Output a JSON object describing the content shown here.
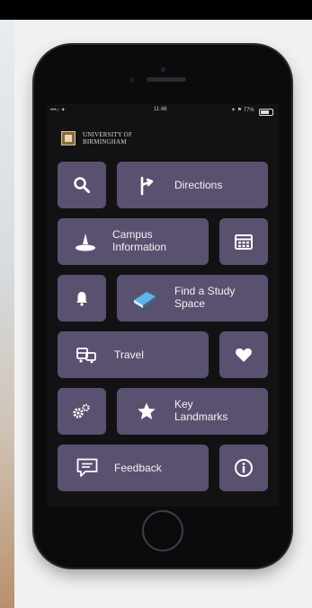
{
  "status_bar": {
    "carrier": "•••○ ✦",
    "time": "11:46",
    "battery": "✦ ⚑ 77%"
  },
  "brand": {
    "line1": "UNIVERSITY OF",
    "line2": "BIRMINGHAM"
  },
  "tiles": {
    "directions": "Directions",
    "campus": [
      "Campus",
      "Information"
    ],
    "study": [
      "Find a Study",
      "Space"
    ],
    "travel": "Travel",
    "landmarks": [
      "Key",
      "Landmarks"
    ],
    "feedback": "Feedback"
  },
  "icons": {
    "search": "search-icon",
    "directions": "directions-icon",
    "campus": "campus-icon",
    "calendar": "calendar-icon",
    "bell": "bell-icon",
    "study": "book-icon",
    "travel": "bus-icon",
    "heart": "heart-icon",
    "settings": "gears-icon",
    "landmarks": "star-icon",
    "feedback": "chat-icon",
    "info": "info-icon"
  },
  "colors": {
    "tile": "#5a5170",
    "screen": "#121214",
    "accent": "#f2f2f2"
  }
}
